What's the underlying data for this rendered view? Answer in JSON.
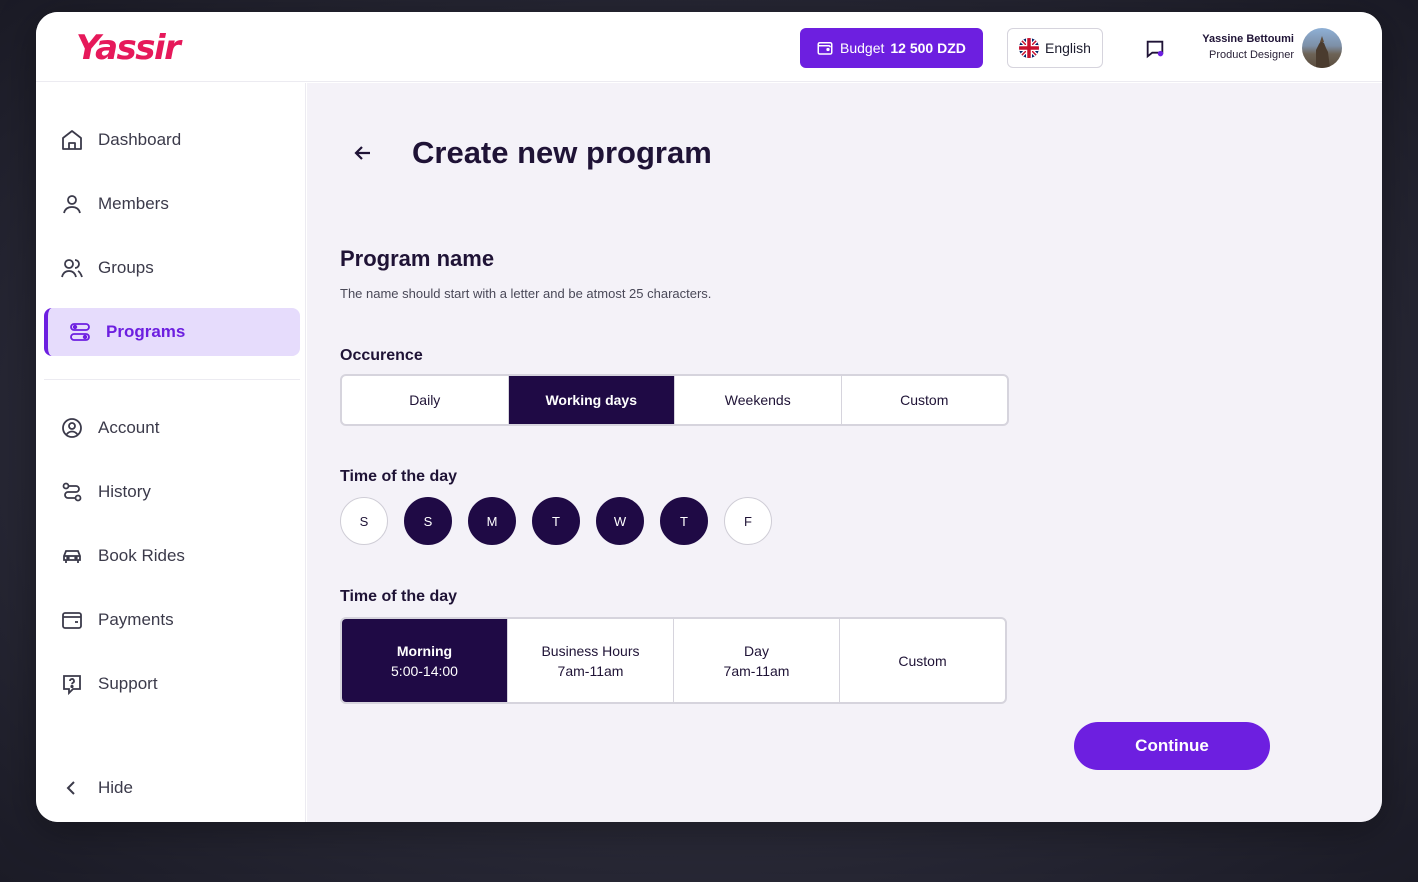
{
  "brand": {
    "logo_text": "Yassir",
    "accent": "#6d1fe0",
    "logo_color": "#e6195a",
    "dark": "#1f0a45"
  },
  "header": {
    "budget_label": "Budget",
    "budget_amount": "12 500 DZD",
    "language": "English",
    "user_name": "Yassine Bettoumi",
    "user_role": "Product Designer"
  },
  "sidebar": {
    "items": [
      {
        "label": "Dashboard",
        "icon": "home-icon"
      },
      {
        "label": "Members",
        "icon": "user-icon"
      },
      {
        "label": "Groups",
        "icon": "users-icon"
      },
      {
        "label": "Programs",
        "icon": "programs-icon",
        "active": true
      },
      {
        "label": "Account",
        "icon": "account-circle-icon"
      },
      {
        "label": "History",
        "icon": "route-icon"
      },
      {
        "label": "Book Rides",
        "icon": "car-icon"
      },
      {
        "label": "Payments",
        "icon": "wallet-icon"
      },
      {
        "label": "Support",
        "icon": "help-chat-icon"
      }
    ],
    "hide_label": "Hide"
  },
  "main": {
    "title": "Create new program",
    "program_name_title": "Program name",
    "program_name_hint": "The name should start with a letter and be atmost 25 characters.",
    "occurrence_label": "Occurence",
    "occurrence_options": [
      "Daily",
      "Working days",
      "Weekends",
      "Custom"
    ],
    "occurrence_selected": "Working days",
    "days_label": "Time of the day",
    "days": [
      {
        "letter": "S",
        "selected": false
      },
      {
        "letter": "S",
        "selected": true
      },
      {
        "letter": "M",
        "selected": true
      },
      {
        "letter": "T",
        "selected": true
      },
      {
        "letter": "W",
        "selected": true
      },
      {
        "letter": "T",
        "selected": true
      },
      {
        "letter": "F",
        "selected": false
      }
    ],
    "time_label": "Time of the day",
    "time_slots": [
      {
        "name": "Morning",
        "range": "5:00-14:00",
        "selected": true
      },
      {
        "name": "Business Hours",
        "range": "7am-11am",
        "selected": false
      },
      {
        "name": "Day",
        "range": "7am-11am",
        "selected": false
      },
      {
        "name": "Custom",
        "range": "",
        "selected": false
      }
    ],
    "continue_label": "Continue"
  }
}
